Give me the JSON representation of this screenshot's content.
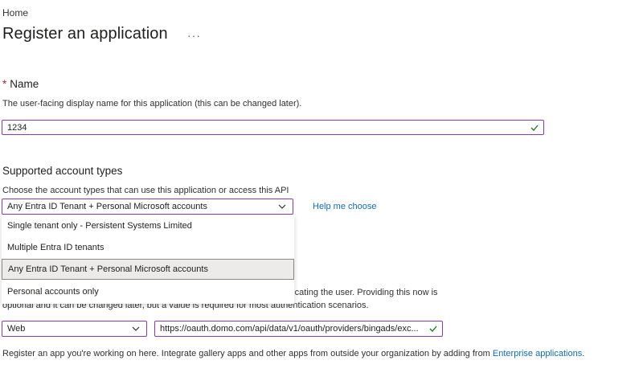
{
  "breadcrumb": {
    "home": "Home"
  },
  "page": {
    "title": "Register an application",
    "more": "···"
  },
  "name_section": {
    "required_mark": "*",
    "heading": "Name",
    "description": "The user-facing display name for this application (this can be changed later).",
    "value": "1234"
  },
  "account_types": {
    "heading": "Supported account types",
    "description": "Choose the account types that can use this application or access this API",
    "selected": "Any Entra ID Tenant + Personal Microsoft accounts",
    "help_link": "Help me choose",
    "options": [
      "Single tenant only - Persistent Systems Limited",
      "Multiple Entra ID tenants",
      "Any Entra ID Tenant + Personal Microsoft accounts",
      "Personal accounts only"
    ]
  },
  "redirect": {
    "partial_line1": "nticating the user. Providing this now is",
    "line2": "optional and it can be changed later, but a value is required for most authentication scenarios.",
    "platform": "Web",
    "uri": "https://oauth.domo.com/api/data/v1/oauth/providers/bingads/exc..."
  },
  "footer": {
    "text": "Register an app you're working on here. Integrate gallery apps and other apps from outside your organization by adding from ",
    "link": "Enterprise applications",
    "end": "."
  },
  "colors": {
    "focus_border": "#8a3ab9",
    "link": "#0f6cbd",
    "check": "#107c10"
  },
  "icons": {
    "valid": "checkmark-icon",
    "expand": "chevron-down-icon",
    "more": "ellipsis-icon"
  }
}
